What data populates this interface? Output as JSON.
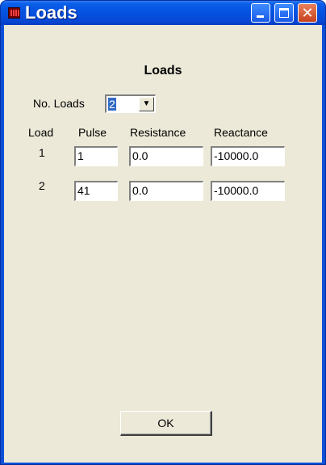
{
  "window": {
    "title": "Loads"
  },
  "dialog": {
    "heading": "Loads",
    "num_loads_label": "No. Loads",
    "num_loads_value": "2",
    "columns": {
      "load": "Load",
      "pulse": "Pulse",
      "resistance": "Resistance",
      "reactance": "Reactance"
    },
    "rows": [
      {
        "load": "1",
        "pulse": "1",
        "resistance": "0.0",
        "reactance": "-10000.0"
      },
      {
        "load": "2",
        "pulse": "41",
        "resistance": "0.0",
        "reactance": "-10000.0"
      }
    ],
    "ok_label": "OK"
  },
  "icons": {
    "app": "app-icon",
    "minimize": "minimize-icon",
    "maximize": "maximize-icon",
    "close": "close-icon",
    "dropdown": "chevron-down-icon"
  }
}
